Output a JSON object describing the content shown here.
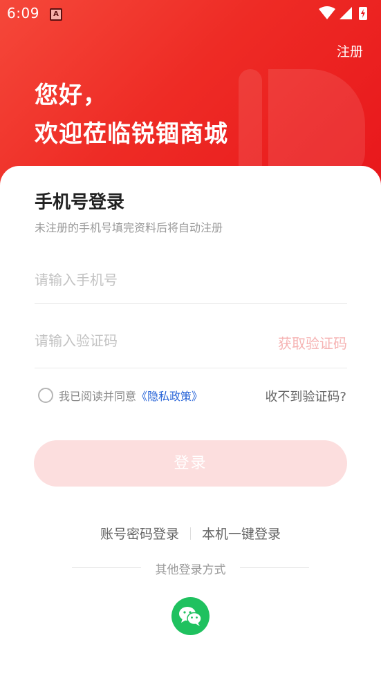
{
  "status_bar": {
    "time": "6:09",
    "notification_icon": "a-icon"
  },
  "header": {
    "register_label": "注册",
    "greeting_line1": "您好，",
    "greeting_line2": "欢迎莅临锐锢商城"
  },
  "login": {
    "title": "手机号登录",
    "subtitle": "未注册的手机号填完资料后将自动注册",
    "phone_placeholder": "请输入手机号",
    "code_placeholder": "请输入验证码",
    "get_code_label": "获取验证码",
    "agree_text": "我已阅读并同意",
    "policy_label": "《隐私政策》",
    "no_code_label": "收不到验证码?",
    "login_button": "登录"
  },
  "alt_login": {
    "password_login": "账号密码登录",
    "one_click_login": "本机一键登录",
    "other_methods": "其他登录方式"
  },
  "colors": {
    "brand_red": "#ee2b25",
    "login_button_disabled": "#fcdede",
    "get_code_disabled": "#f6b3b3",
    "policy_link": "#2a66d8",
    "wechat_green": "#1fc15f"
  }
}
